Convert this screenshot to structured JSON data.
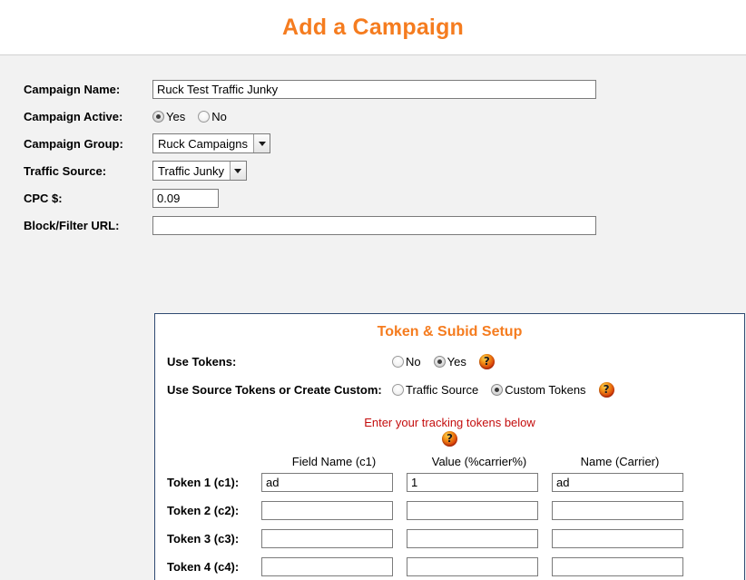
{
  "header": {
    "title": "Add a Campaign"
  },
  "form": {
    "fields": [
      {
        "label": "Campaign Name:",
        "value": "Ruck Test Traffic Junky"
      },
      {
        "label": "Campaign Active:"
      },
      {
        "label": "Campaign Group:",
        "value": "Ruck Campaigns"
      },
      {
        "label": "Traffic Source:",
        "value": "Traffic Junky"
      },
      {
        "label": "CPC $:",
        "value": "0.09"
      },
      {
        "label": "Block/Filter URL:",
        "value": ""
      }
    ],
    "campaign_active": {
      "options": [
        {
          "label": "Yes",
          "selected": true
        },
        {
          "label": "No",
          "selected": false
        }
      ]
    }
  },
  "token_panel": {
    "title": "Token & Subid Setup",
    "use_tokens": {
      "label": "Use Tokens:",
      "options": [
        {
          "label": "No",
          "selected": false
        },
        {
          "label": "Yes",
          "selected": true
        }
      ],
      "help_icon": "help-question-icon"
    },
    "source_or_custom": {
      "label": "Use Source Tokens or Create Custom:",
      "options": [
        {
          "label": "Traffic Source",
          "selected": false
        },
        {
          "label": "Custom Tokens",
          "selected": true
        }
      ],
      "help_icon": "help-question-icon"
    },
    "tracking_note": "Enter your tracking tokens below",
    "tracking_note_help_icon": "help-question-icon",
    "columns": [
      "Field Name (c1)",
      "Value (%carrier%)",
      "Name (Carrier)"
    ],
    "rows": [
      {
        "label": "Token 1 (c1):",
        "field_name": "ad",
        "value": "1",
        "name": "ad"
      },
      {
        "label": "Token 2 (c2):",
        "field_name": "",
        "value": "",
        "name": ""
      },
      {
        "label": "Token 3 (c3):",
        "field_name": "",
        "value": "",
        "name": ""
      },
      {
        "label": "Token 4 (c4):",
        "field_name": "",
        "value": "",
        "name": ""
      }
    ]
  },
  "colors": {
    "accent_orange": "#f57c1f",
    "note_red": "#c40d0d",
    "panel_border": "#2f4a72",
    "page_background": "#f2f2f2"
  }
}
